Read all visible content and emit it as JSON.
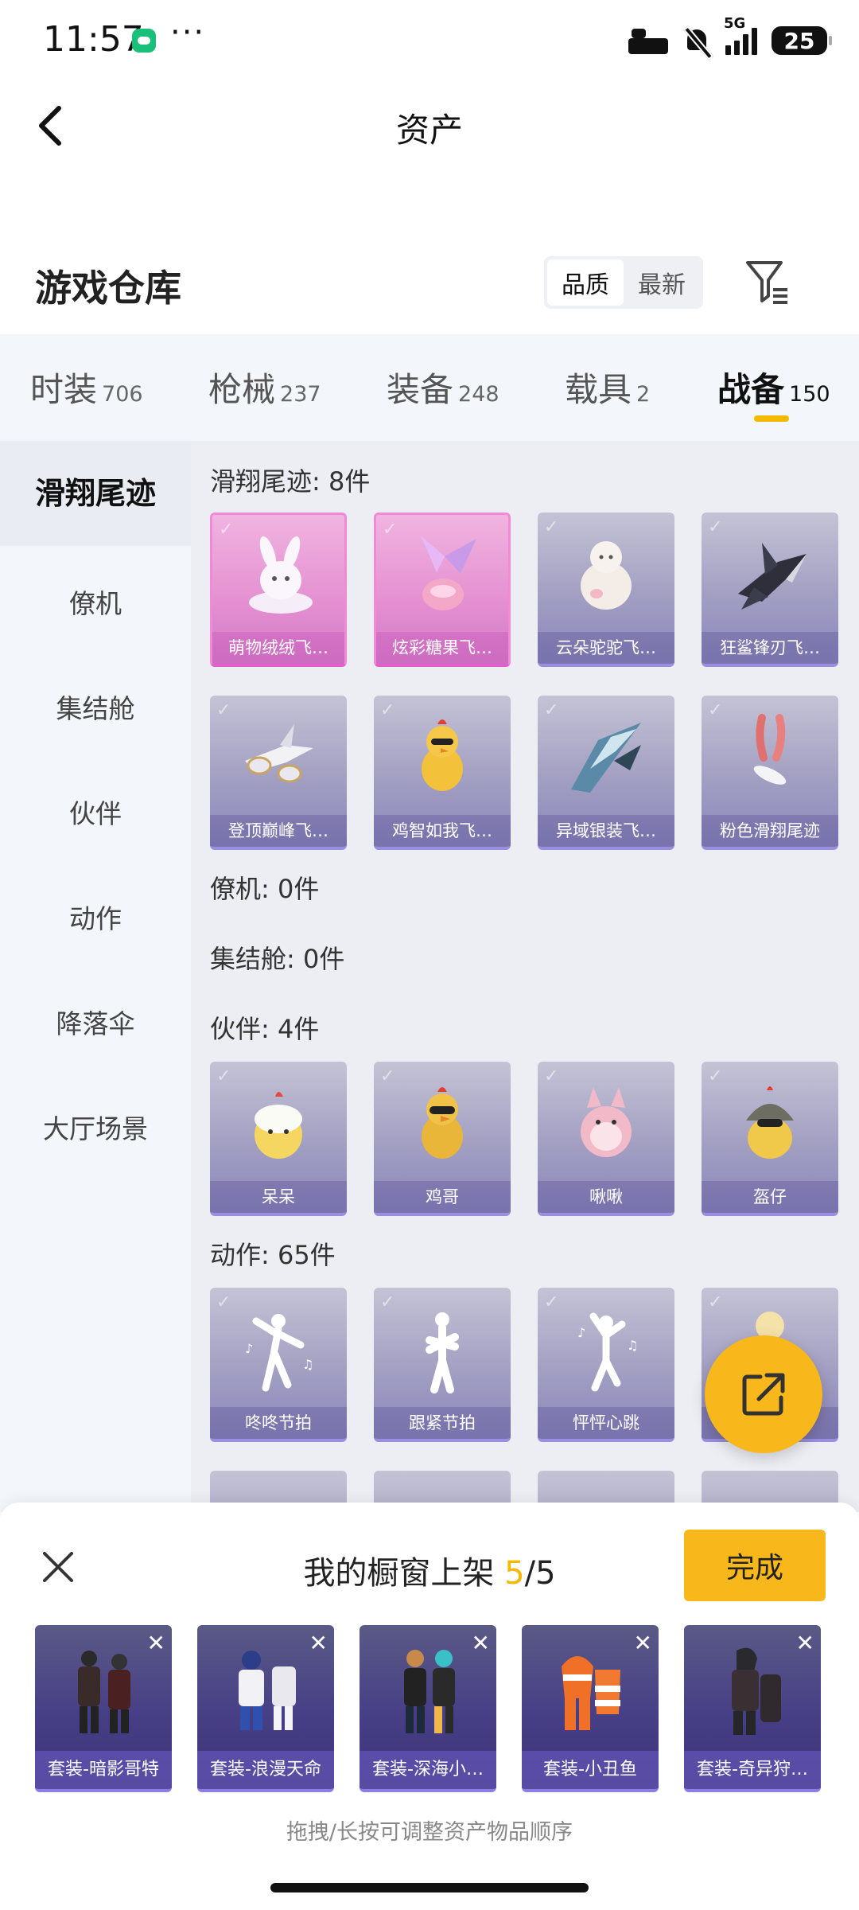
{
  "status": {
    "time": "11:57",
    "more": "···",
    "network": "5G",
    "battery": "25"
  },
  "header": {
    "title": "资产"
  },
  "warehouse": {
    "title": "游戏仓库",
    "sort": [
      "品质",
      "最新"
    ],
    "active_sort": 0
  },
  "tabs": [
    {
      "label": "时装",
      "count": "706"
    },
    {
      "label": "枪械",
      "count": "237"
    },
    {
      "label": "装备",
      "count": "248"
    },
    {
      "label": "载具",
      "count": "2"
    },
    {
      "label": "战备",
      "count": "150"
    }
  ],
  "active_tab": 4,
  "sidebar": {
    "items": [
      "滑翔尾迹",
      "僚机",
      "集结舱",
      "伙伴",
      "动作",
      "降落伞",
      "大厅场景"
    ],
    "active": 0
  },
  "sections": {
    "glide": {
      "title": "滑翔尾迹: 8件",
      "items": [
        "萌物绒绒飞…",
        "炫彩糖果飞…",
        "云朵驼驼飞…",
        "狂鲨锋刃飞…",
        "登顶巅峰飞…",
        "鸡智如我飞…",
        "异域银装飞…",
        "粉色滑翔尾迹"
      ]
    },
    "wingman": {
      "title": "僚机: 0件"
    },
    "capsule": {
      "title": "集结舱: 0件"
    },
    "partner": {
      "title": "伙伴: 4件",
      "items": [
        "呆呆",
        "鸡哥",
        "啾啾",
        "盔仔"
      ]
    },
    "emote": {
      "title": "动作: 65件",
      "items": [
        "咚咚节拍",
        "跟紧节拍",
        "怦怦心跳",
        ""
      ]
    }
  },
  "window": {
    "title_prefix": "我的橱窗上架 ",
    "count": "5",
    "total": "/5",
    "done_label": "完成",
    "items": [
      "套装-暗影哥特",
      "套装-浪漫天命",
      "套装-深海小…",
      "套装-小丑鱼",
      "套装-奇异狩…"
    ],
    "hint": "拖拽/长按可调整资产物品顺序"
  },
  "colors": {
    "accent": "#f8b71a",
    "rare_pink": "#e48fd0",
    "card_purple": "#a29fc2"
  },
  "icons": [
    "back-arrow-icon",
    "filter-icon",
    "share-export-icon",
    "close-icon",
    "remove-icon",
    "checkmark-icon",
    "wechat-icon",
    "bed-icon",
    "mute-icon",
    "signal-icon",
    "battery-icon"
  ]
}
